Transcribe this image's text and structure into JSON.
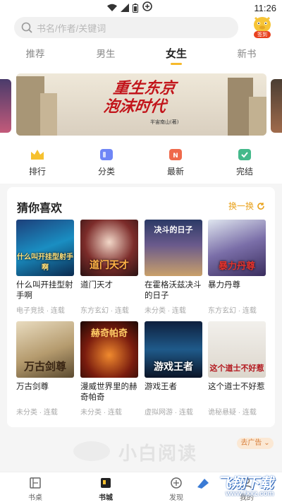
{
  "status_bar": {
    "time": "11:26"
  },
  "search": {
    "placeholder": "书名/作者/关键词"
  },
  "signin": {
    "label": "签到"
  },
  "tabs": [
    {
      "label": "推荐"
    },
    {
      "label": "男生"
    },
    {
      "label": "女生",
      "active": true
    },
    {
      "label": "新书"
    }
  ],
  "banner": {
    "title_line1": "重生东京",
    "title_line2": "泡沫时代",
    "author": "半宙南山(著)"
  },
  "categories": [
    {
      "label": "排行",
      "icon": "crown-icon",
      "color": "#f6c12f"
    },
    {
      "label": "分类",
      "icon": "category-icon",
      "color": "#6f86f6"
    },
    {
      "label": "最新",
      "icon": "new-icon",
      "color": "#ef6a4c"
    },
    {
      "label": "完结",
      "icon": "check-icon",
      "color": "#44b98b"
    }
  ],
  "guess": {
    "title": "猜你喜欢",
    "refresh_label": "换一换",
    "books": [
      {
        "name": "什么叫开挂型射手啊",
        "meta": "电子竞技 · 连载",
        "cover_text": "什么叫开挂型射手啊"
      },
      {
        "name": "道门天才",
        "meta": "东方玄幻 · 连载",
        "cover_text": "道门天才"
      },
      {
        "name": "在霍格沃兹决斗的日子",
        "meta": "未分类 · 连载",
        "cover_text": "决斗的日子"
      },
      {
        "name": "暴力丹尊",
        "meta": "东方玄幻 · 连载",
        "cover_text": "暴力丹尊"
      },
      {
        "name": "万古剑尊",
        "meta": "未分类 · 连载",
        "cover_text": "万古剑尊"
      },
      {
        "name": "漫威世界里的赫奇帕奇",
        "meta": "未分类 · 连载",
        "cover_text": "赫奇帕奇"
      },
      {
        "name": "游戏王者",
        "meta": "虚拟网游 · 连载",
        "cover_text": "游戏王者"
      },
      {
        "name": "这个道士不好惹",
        "meta": "诡秘悬疑 · 连载",
        "cover_text": "这个道士不好惹"
      }
    ]
  },
  "ad": {
    "logo": "小白阅读",
    "tag": "去广告"
  },
  "bottom_nav": [
    {
      "label": "书桌"
    },
    {
      "label": "书城",
      "active": true
    },
    {
      "label": "发现"
    },
    {
      "label": "我的"
    }
  ],
  "watermark": {
    "text": "飞翔下载",
    "url": "www.fxxz.com"
  }
}
